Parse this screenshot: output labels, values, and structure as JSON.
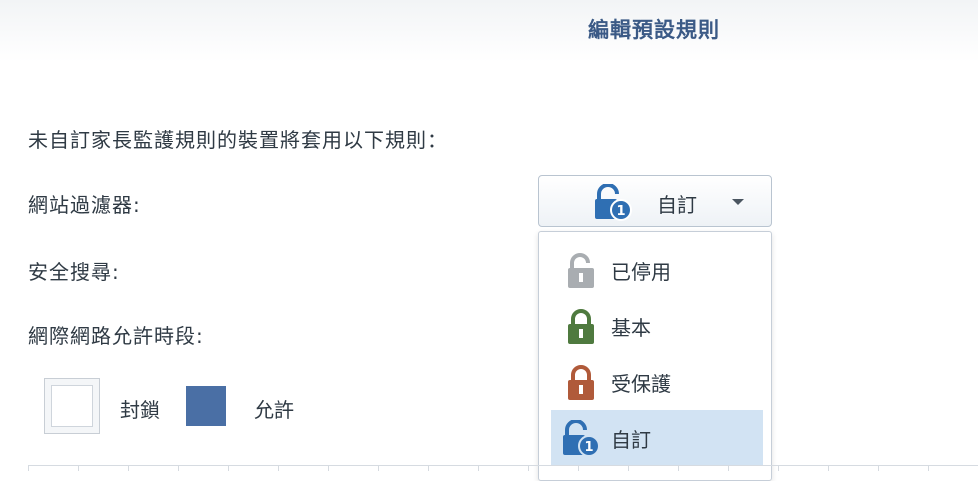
{
  "dialog": {
    "title": "編輯預設規則"
  },
  "description": "未自訂家長監護規則的裝置將套用以下規則：",
  "rows": {
    "web_filter_label": "網站過濾器:",
    "safe_search_label": "安全搜尋:",
    "internet_time_label": "網際網路允許時段:"
  },
  "web_filter_select": {
    "selected": "自訂",
    "icon": "lock-custom-icon",
    "options": [
      {
        "label": "已停用",
        "icon": "lock-disabled-icon",
        "color": "#a9adb1",
        "state": "open"
      },
      {
        "label": "基本",
        "icon": "lock-basic-icon",
        "color": "#4f7a3f",
        "state": "closed"
      },
      {
        "label": "受保護",
        "icon": "lock-protected-icon",
        "color": "#b05a3a",
        "state": "closed"
      },
      {
        "label": "自訂",
        "icon": "lock-custom-icon",
        "color": "#2f6fb3",
        "state": "custom"
      }
    ],
    "selected_index": 3
  },
  "legend": {
    "block_label": "封鎖",
    "allow_label": "允許",
    "allow_color": "#4a6fa5"
  }
}
